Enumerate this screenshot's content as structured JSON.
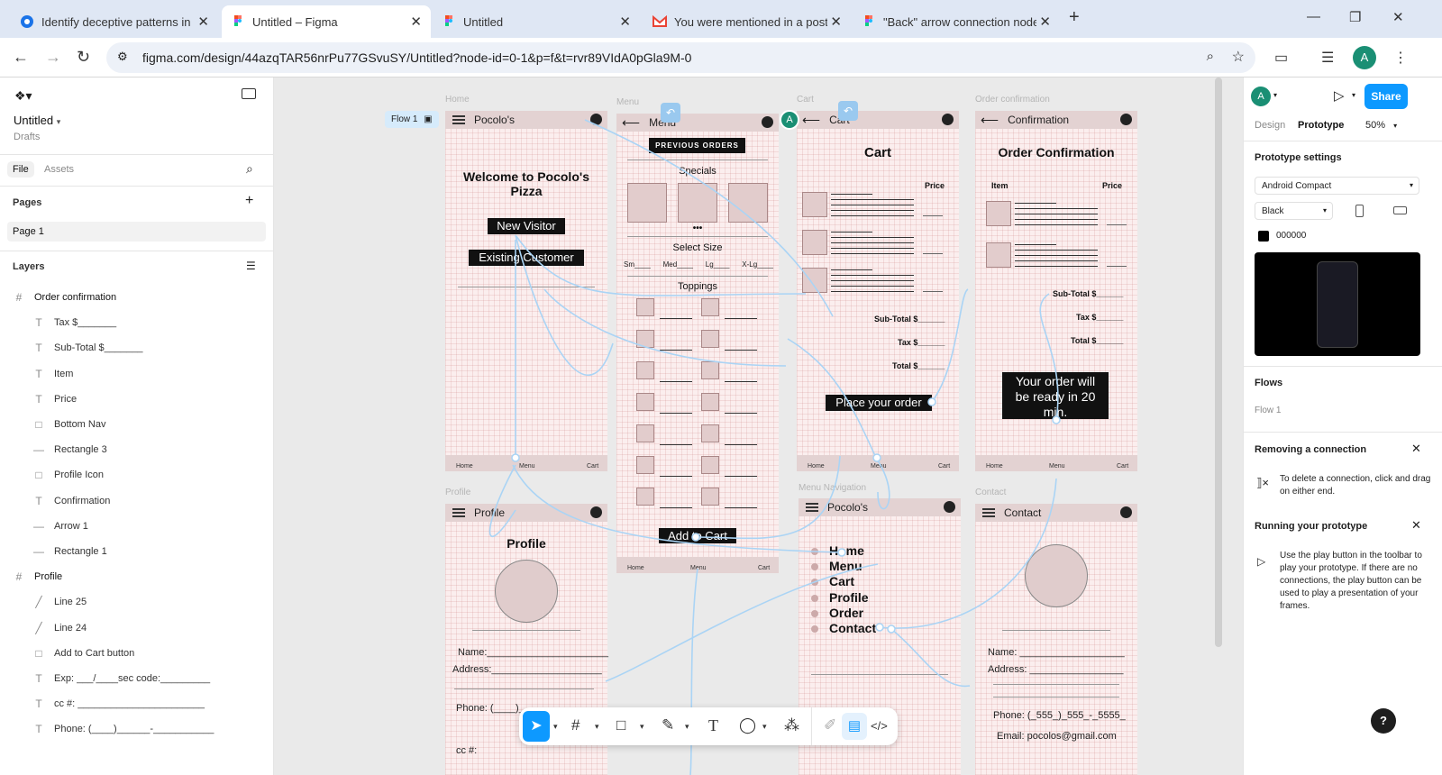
{
  "browser": {
    "tabs": [
      {
        "title": "Identify deceptive patterns in U",
        "icon": "chrome-icon"
      },
      {
        "title": "Untitled – Figma",
        "icon": "figma-icon",
        "active": true
      },
      {
        "title": "Untitled",
        "icon": "figma-icon"
      },
      {
        "title": "You were mentioned in a post -",
        "icon": "gmail-icon"
      },
      {
        "title": "\"Back\" arrow connection nodes",
        "icon": "figma-icon"
      }
    ],
    "new_tab": "+",
    "url": "figma.com/design/44azqTAR56nrPu77GSvuSY/Untitled?node-id=0-1&p=f&t=rvr89VIdA0pGla9M-0",
    "profile_initial": "A"
  },
  "left_panel": {
    "file_name": "Untitled",
    "location": "Drafts",
    "tabs": {
      "file": "File",
      "assets": "Assets"
    },
    "pages_label": "Pages",
    "current_page": "Page 1",
    "layers_label": "Layers",
    "layers": [
      {
        "name": "Order confirmation",
        "type": "frame"
      },
      {
        "name": "Tax $_______",
        "type": "text"
      },
      {
        "name": "Sub-Total $_______",
        "type": "text"
      },
      {
        "name": "Item",
        "type": "text"
      },
      {
        "name": "Price",
        "type": "text"
      },
      {
        "name": "Bottom Nav",
        "type": "rect"
      },
      {
        "name": "Rectangle 3",
        "type": "line"
      },
      {
        "name": "Profile Icon",
        "type": "rect"
      },
      {
        "name": "Confirmation",
        "type": "text"
      },
      {
        "name": "Arrow 1",
        "type": "line"
      },
      {
        "name": "Rectangle 1",
        "type": "line"
      },
      {
        "name": "Profile",
        "type": "frame"
      },
      {
        "name": "Line 25",
        "type": "vector"
      },
      {
        "name": "Line 24",
        "type": "vector"
      },
      {
        "name": "Add to Cart button",
        "type": "rect"
      },
      {
        "name": "Exp: ___/____sec code:_________",
        "type": "text"
      },
      {
        "name": "cc #: _______________________",
        "type": "text"
      },
      {
        "name": "Phone: (____)______-___________",
        "type": "text"
      }
    ]
  },
  "canvas": {
    "flow_badge": "Flow 1",
    "frames": {
      "home": {
        "label": "Home",
        "brand": "Pocolo's",
        "title": "Welcome to Pocolo's Pizza",
        "new_visitor": "New Visitor",
        "existing": "Existing Customer"
      },
      "menu": {
        "label": "Menu",
        "header": "Menu",
        "prev_orders": "PREVIOUS ORDERS",
        "specials": "Specials",
        "dots": "•••",
        "select_size": "Select Size",
        "sizes": [
          "Sm____",
          "Med____",
          "Lg____",
          "X-Lg____"
        ],
        "toppings": "Toppings",
        "add_to_cart": "Add to Cart"
      },
      "cart": {
        "label": "Cart",
        "header": "Cart",
        "title": "Cart",
        "price": "Price",
        "subtotal": "Sub-Total $______",
        "tax": "Tax $______",
        "total": "Total $______",
        "place_order": "Place your order"
      },
      "order": {
        "label": "Order confirmation",
        "header": "Confirmation",
        "title": "Order Confirmation",
        "item": "Item",
        "price": "Price",
        "subtotal": "Sub-Total $______",
        "tax": "Tax $______",
        "total": "Total $______",
        "ready": "Your order will be ready in 20 min."
      },
      "profile": {
        "label": "Profile",
        "header": "Profile",
        "title": "Profile",
        "name": "Name:______________________",
        "address": "Address:____________________",
        "phone": "Phone: (____)______",
        "cc": "cc #:"
      },
      "menunav": {
        "label": "Menu Navigation",
        "brand": "Pocolo's",
        "items": [
          "Home",
          "Menu",
          "Cart",
          "Profile",
          "Order",
          "Contact"
        ]
      },
      "contact": {
        "label": "Contact",
        "header": "Contact",
        "name": "Name: ___________________",
        "address": "Address: _________________",
        "phone": "Phone: (_555_)_555_-_5555_",
        "email": "Email:  pocolos@gmail.com"
      }
    },
    "bottom_nav": [
      "Home",
      "Menu",
      "Cart"
    ]
  },
  "right_panel": {
    "avatar": "A",
    "share": "Share",
    "tabs": {
      "design": "Design",
      "prototype": "Prototype"
    },
    "zoom": "50%",
    "proto_settings": "Prototype settings",
    "device": "Android Compact",
    "model_color": "Black",
    "bg_hex": "000000",
    "flows_label": "Flows",
    "flow_item": "Flow 1",
    "tip1_title": "Removing a connection",
    "tip1_text": "To delete a connection, click and drag on either end.",
    "tip2_title": "Running your prototype",
    "tip2_text": "Use the play button in the toolbar to play your prototype. If there are no connections, the play button can be used to play a presentation of your frames."
  },
  "colors": {
    "accent": "#0d99ff",
    "connector": "#aad4f5",
    "frame_bg": "#fbeeee"
  }
}
